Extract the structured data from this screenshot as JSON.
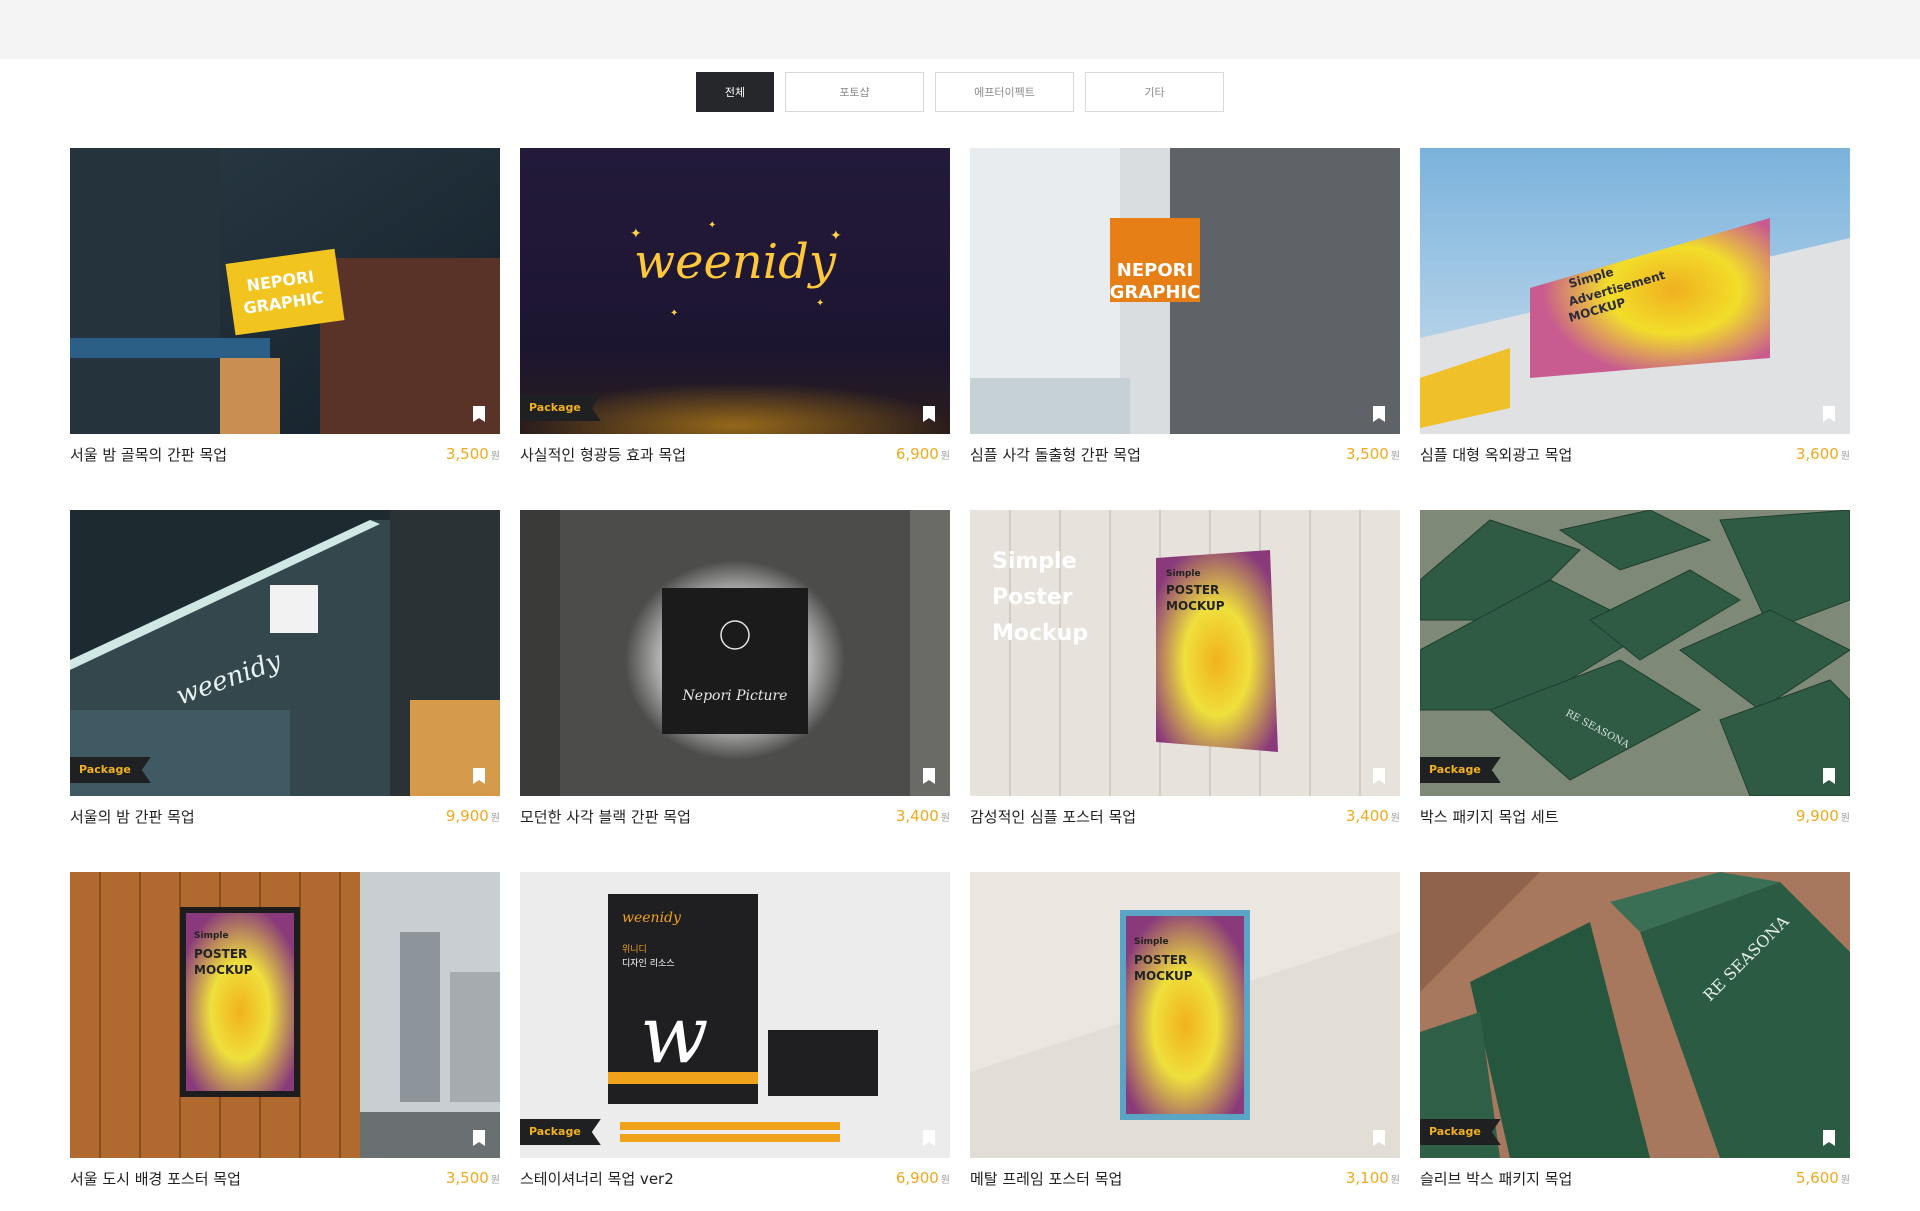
{
  "filters": [
    {
      "label": "전체",
      "active": true
    },
    {
      "label": "포토샵",
      "active": false
    },
    {
      "label": "에프터이펙트",
      "active": false
    },
    {
      "label": "기타",
      "active": false
    }
  ],
  "currency": "원",
  "products": [
    {
      "title": "서울 밤 골목의 간판 목업",
      "price": "3,500",
      "package": false,
      "sign_text": [
        "NEPORI",
        "GRAPHIC"
      ]
    },
    {
      "title": "사실적인 형광등 효과 목업",
      "price": "6,900",
      "package": true,
      "badge": "Package",
      "sign_text": [
        "weenidy"
      ]
    },
    {
      "title": "심플 사각 돌출형 간판 목업",
      "price": "3,500",
      "package": false,
      "sign_text": [
        "NEPORI",
        "GRAPHIC"
      ]
    },
    {
      "title": "심플 대형 옥외광고 목업",
      "price": "3,600",
      "package": false,
      "sign_text": [
        "Simple",
        "Advertisement",
        "MOCKUP"
      ]
    },
    {
      "title": "서울의 밤 간판 목업",
      "price": "9,900",
      "package": true,
      "badge": "Package",
      "sign_text": [
        "weenidy"
      ]
    },
    {
      "title": "모던한 사각 블랙 간판 목업",
      "price": "3,400",
      "package": false,
      "sign_text": [
        "Nepori Picture"
      ]
    },
    {
      "title": "감성적인 심플 포스터 목업",
      "price": "3,400",
      "package": false,
      "sign_text": [
        "Simple",
        "Poster",
        "Mockup",
        "Simple",
        "POSTER",
        "MOCKUP"
      ]
    },
    {
      "title": "박스 패키지 목업 세트",
      "price": "9,900",
      "package": true,
      "badge": "Package",
      "sign_text": [
        "RE SEASONA"
      ]
    },
    {
      "title": "서울 도시 배경 포스터 목업",
      "price": "3,500",
      "package": false,
      "sign_text": [
        "Simple",
        "POSTER",
        "MOCKUP"
      ]
    },
    {
      "title": "스테이셔너리 목업 ver2",
      "price": "6,900",
      "package": true,
      "badge": "Package",
      "sign_text": [
        "weenidy",
        "위니디",
        "디자인 리소스"
      ]
    },
    {
      "title": "메탈 프레임 포스터 목업",
      "price": "3,100",
      "package": false,
      "sign_text": [
        "Simple",
        "POSTER",
        "MOCKUP"
      ]
    },
    {
      "title": "슬리브 박스 패키지 목업",
      "price": "5,600",
      "package": true,
      "badge": "Package",
      "sign_text": [
        "RE SEASONA"
      ]
    }
  ],
  "colors": {
    "accent_price": "#f2a91b",
    "badge_text": "#f2b21b",
    "active_tab": "#26272b"
  },
  "icons": {
    "bookmark": "bookmark-icon"
  }
}
